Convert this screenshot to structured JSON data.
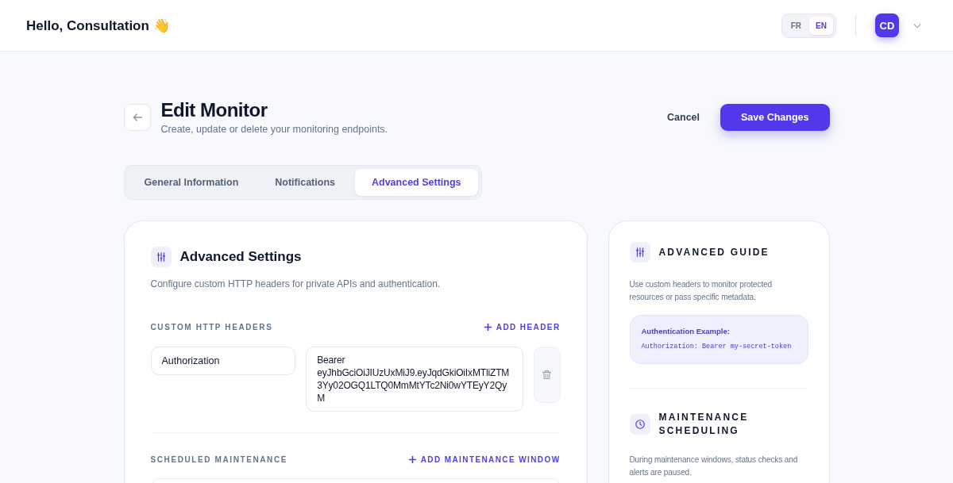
{
  "header": {
    "greeting": "Hello, Consultation 👋",
    "languages": [
      {
        "label": "FR",
        "selected": false
      },
      {
        "label": "EN",
        "selected": true
      }
    ],
    "avatar": "CD"
  },
  "page": {
    "title": "Edit Monitor",
    "subtitle": "Create, update or delete your monitoring endpoints.",
    "cancel": "Cancel",
    "save": "Save Changes"
  },
  "tabs": [
    {
      "label": "General Information",
      "selected": false
    },
    {
      "label": "Notifications",
      "selected": false
    },
    {
      "label": "Advanced Settings",
      "selected": true
    }
  ],
  "settings": {
    "title": "Advanced Settings",
    "description": "Configure custom HTTP headers for private APIs and authentication.",
    "headers_label": "CUSTOM HTTP HEADERS",
    "add_header": "ADD HEADER",
    "headers": [
      {
        "name": "Authorization",
        "value": "Bearer eyJhbGciOiJIUzUxMiJ9.eyJqdGkiOiIxMTliZTM3Yy02OGQ1LTQ0MmMtYTc2Ni0wYTEyY2QyM"
      }
    ],
    "maintenance_label": "SCHEDULED MAINTENANCE",
    "add_maintenance": "ADD MAINTENANCE WINDOW"
  },
  "guide": {
    "sections": [
      {
        "kind": "sliders",
        "title": "ADVANCED GUIDE",
        "text": "Use custom headers to monitor protected resources or pass specific metadata.",
        "example_title": "Authentication Example:",
        "example_code": "Authorization: Bearer my-secret-token"
      },
      {
        "kind": "clock",
        "title": "MAINTENANCE SCHEDULING",
        "text": "During maintenance windows, status checks and alerts are paused."
      }
    ]
  }
}
